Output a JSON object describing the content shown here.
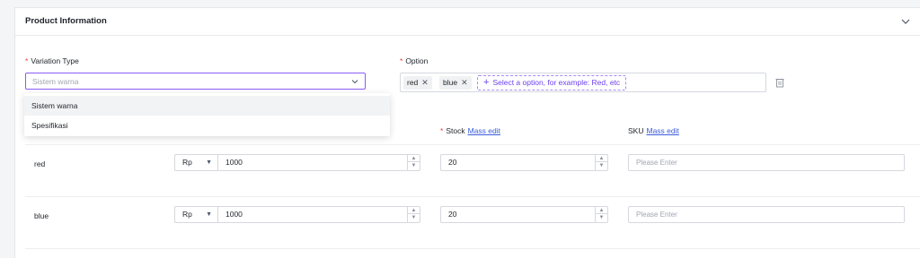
{
  "section": {
    "title": "Product Information"
  },
  "variation_type": {
    "label": "Variation Type",
    "placeholder": "Sistem warna",
    "options": [
      "Sistem warna",
      "Spesifikasi"
    ]
  },
  "option": {
    "label": "Option",
    "tags": [
      "red",
      "blue"
    ],
    "add_placeholder": "Select a option, for example: Red, etc"
  },
  "columns": {
    "stock_label": "Stock",
    "stock_mass_edit": "Mass edit",
    "sku_label": "SKU",
    "sku_mass_edit": "Mass edit"
  },
  "rows": [
    {
      "name": "red",
      "currency": "Rp",
      "price": "1000",
      "stock": "20",
      "sku_placeholder": "Please Enter"
    },
    {
      "name": "blue",
      "currency": "Rp",
      "price": "1000",
      "stock": "20",
      "sku_placeholder": "Please Enter"
    }
  ],
  "colors": {
    "accent": "#8b5cf6",
    "required": "#f53f3f",
    "link": "#3b5bdb"
  },
  "icons": [
    "chevron-down-icon",
    "close-icon",
    "plus-icon",
    "trash-icon",
    "spin-up-icon",
    "spin-down-icon"
  ]
}
